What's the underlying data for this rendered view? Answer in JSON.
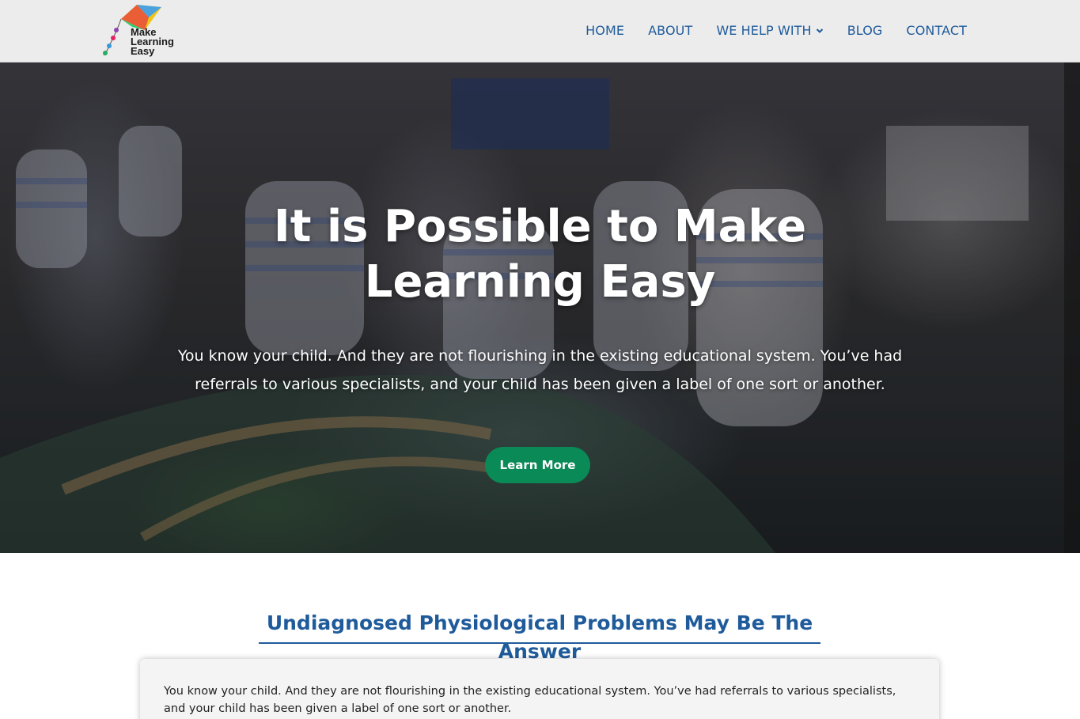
{
  "header": {
    "logo": {
      "line1": "Make",
      "line2": "Learning",
      "line3": "Easy",
      "icon": "kite-icon"
    },
    "nav": [
      {
        "label": "HOME"
      },
      {
        "label": "ABOUT"
      },
      {
        "label": "WE HELP WITH",
        "icon": "chevron-down-icon"
      },
      {
        "label": "BLOG"
      },
      {
        "label": "CONTACT"
      }
    ]
  },
  "hero": {
    "title_line1": "It is Possible to Make",
    "title_line2": "Learning Easy",
    "text": "You know your child. And they are not flourishing in the existing educational system. You’ve had referrals to various specialists, and your child has been given a label of one sort or another.",
    "button_label": "Learn More",
    "button_color": "#0a8a56"
  },
  "section": {
    "title": "Undiagnosed Physiological Problems May Be The Answer",
    "card_text": "You know your child. And they are not flourishing in the existing educational system. You’ve had referrals to various specialists, and your child has been given a label of one sort or another."
  },
  "colors": {
    "nav_link": "#1f5b9b",
    "header_bg": "#ececec"
  }
}
